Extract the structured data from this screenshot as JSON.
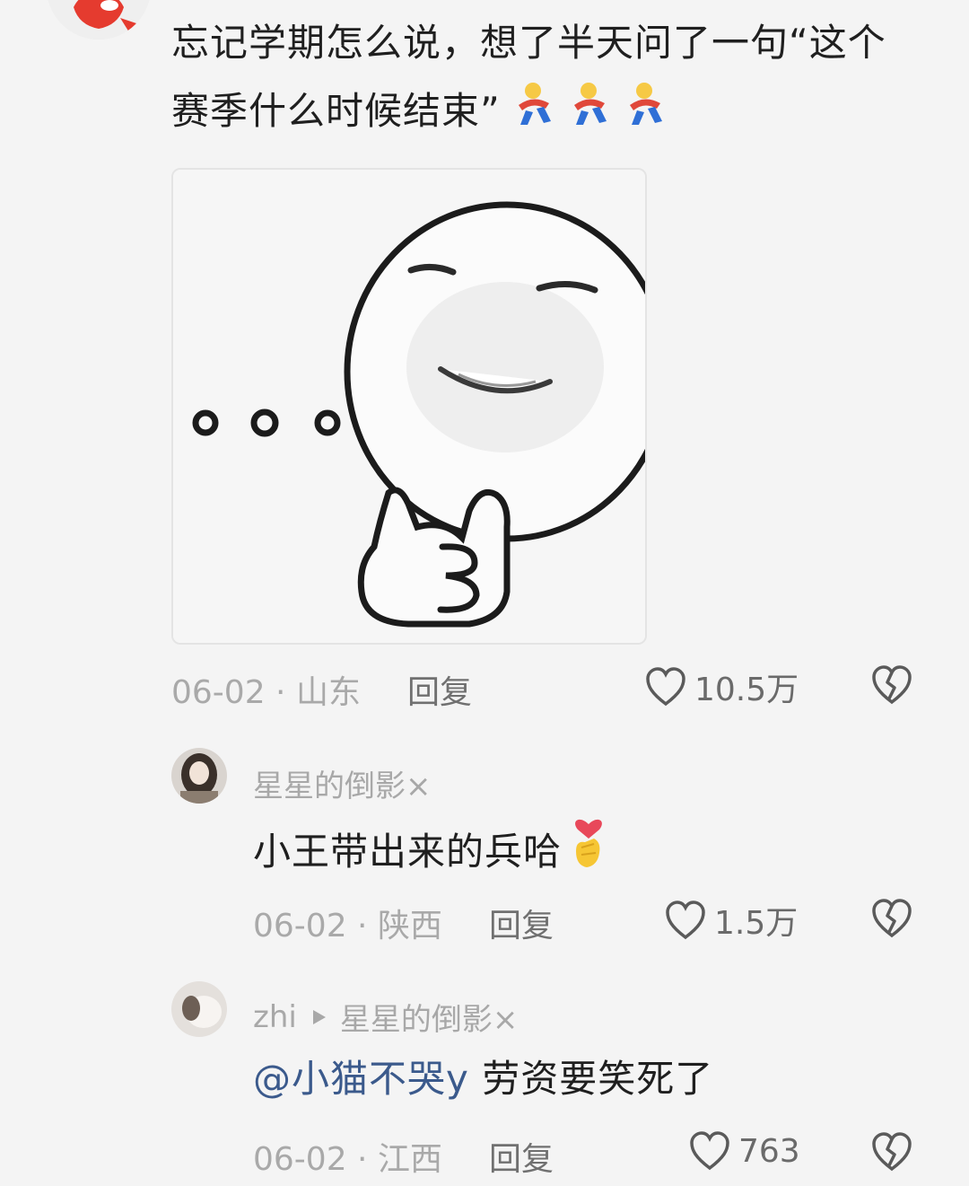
{
  "comments": [
    {
      "text_line1": "忘记学期怎么说，想了半天问了一句“这个",
      "text_line2": "赛季什么时候结束”",
      "meme_icon": "thinking-face-meme",
      "date": "06-02",
      "location": "山东",
      "reply_label": "回复",
      "likes": "10.5万"
    },
    {
      "username": "星星的倒影×",
      "text": "小王带出来的兵哈",
      "date": "06-02",
      "location": "陕西",
      "reply_label": "回复",
      "likes": "1.5万"
    },
    {
      "username": "zhi",
      "reply_to": "星星的倒影×",
      "mention": "@小猫不哭y",
      "text": " 劳资要笑死了",
      "date": "06-02",
      "location": "江西",
      "reply_label": "回复",
      "likes": "763"
    }
  ],
  "separator": " · ",
  "icons": [
    "like-heart-icon",
    "dislike-broken-heart-icon",
    "play-arrow-icon"
  ],
  "colors": {
    "background": "#f4f4f4",
    "mention": "#3b5a8c",
    "meta": "#a9a9a9"
  }
}
